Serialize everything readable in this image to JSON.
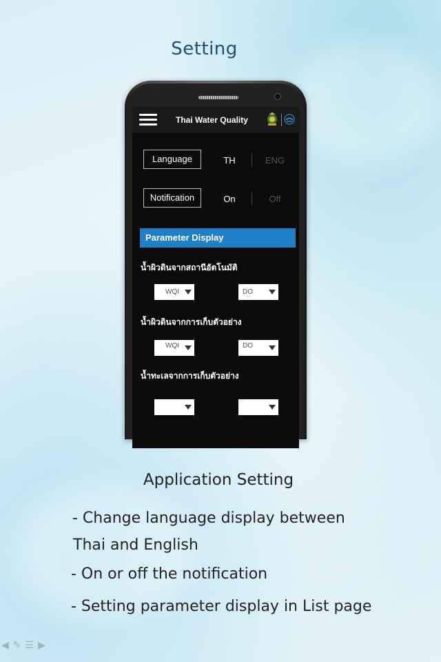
{
  "page": {
    "title": "Setting"
  },
  "app": {
    "title": "Thai Water Quality"
  },
  "settings": {
    "language": {
      "label": "Language",
      "option_1": "TH",
      "option_2": "ENG",
      "selected": "TH"
    },
    "notification": {
      "label": "Notification",
      "option_1": "On",
      "option_2": "Off",
      "selected": "On"
    }
  },
  "parameter_display": {
    "header": "Parameter Display",
    "groups": [
      {
        "label": "น้ำผิวดินจากสถานีอัตโนมัติ",
        "select_1": "WQI",
        "select_2": "DO"
      },
      {
        "label": "น้ำผิวดินจากการเก็บตัวอย่าง",
        "select_1": "WQI",
        "select_2": "DO"
      },
      {
        "label": "น้ำทะเลจากการเก็บตัวอย่าง",
        "select_1": "",
        "select_2": ""
      }
    ]
  },
  "description": {
    "title": "Application Setting",
    "line_1": "- Change language display between",
    "line_2": "Thai and English",
    "line_3": "- On or off the notification",
    "line_4": "- Setting parameter display in List page"
  },
  "colors": {
    "accent": "#1f7fc7",
    "title": "#1e4e78",
    "screen_bg": "#0b0b0b"
  },
  "icons": {
    "menu": "hamburger-icon",
    "logo_1": "department-emblem-icon",
    "logo_2": "agency-logo-icon"
  }
}
